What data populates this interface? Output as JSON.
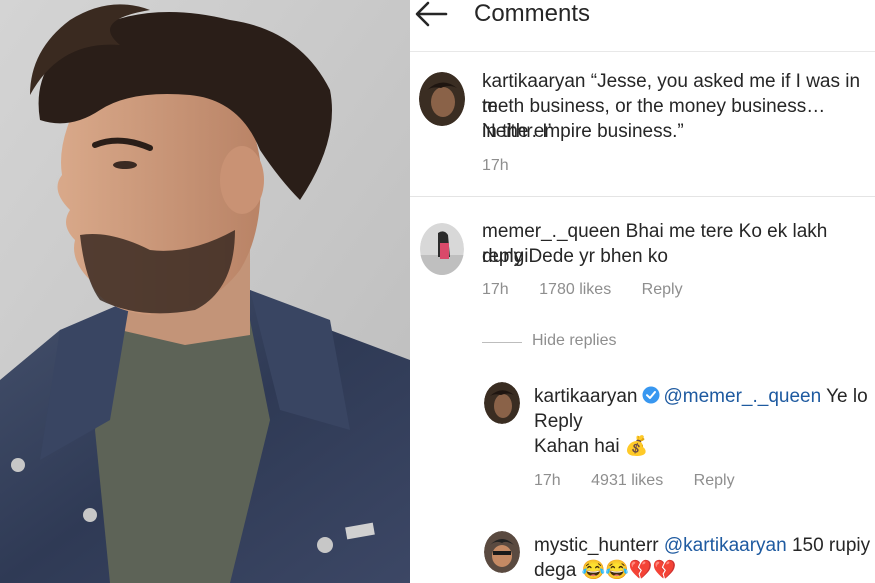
{
  "header": {
    "title": "Comments"
  },
  "comments": [
    {
      "username": "kartikaaryan",
      "text_line1": "“Jesse, you asked me if I was in t",
      "text_line1_tail": "e",
      "text_line2": "meth business, or the money business… Neith",
      "text_line2_tail": "r. I’",
      "text_line3": "in the empire business.”",
      "time": "17h"
    },
    {
      "username": "memer_._queen",
      "text_line1": "Bhai me tere Ko ek lakh dungi",
      "text_line2": "reply Dede yr bhen ko",
      "time": "17h",
      "likes": "1780 likes",
      "reply_label": "Reply"
    }
  ],
  "hide_replies": "Hide replies",
  "replies": [
    {
      "username": "kartikaaryan",
      "mention": "@memer_._queen",
      "text_inline": "Ye lo",
      "text_line2": "Reply",
      "text_line3": "Kahan hai 💰",
      "time": "17h",
      "likes": "4931 likes",
      "reply_label": "Reply"
    },
    {
      "username": "mystic_hunterr",
      "mention": "@kartikaaryan",
      "text_inline": "150 rupiy",
      "text_line2": "dega 😂😂💔💔"
    }
  ],
  "colors": {
    "mention": "#1e5aa0",
    "verified": "#3897f0",
    "meta": "#8e8e8e"
  },
  "icons": {
    "back": "arrow-left-icon",
    "verified": "verified-badge-icon"
  }
}
